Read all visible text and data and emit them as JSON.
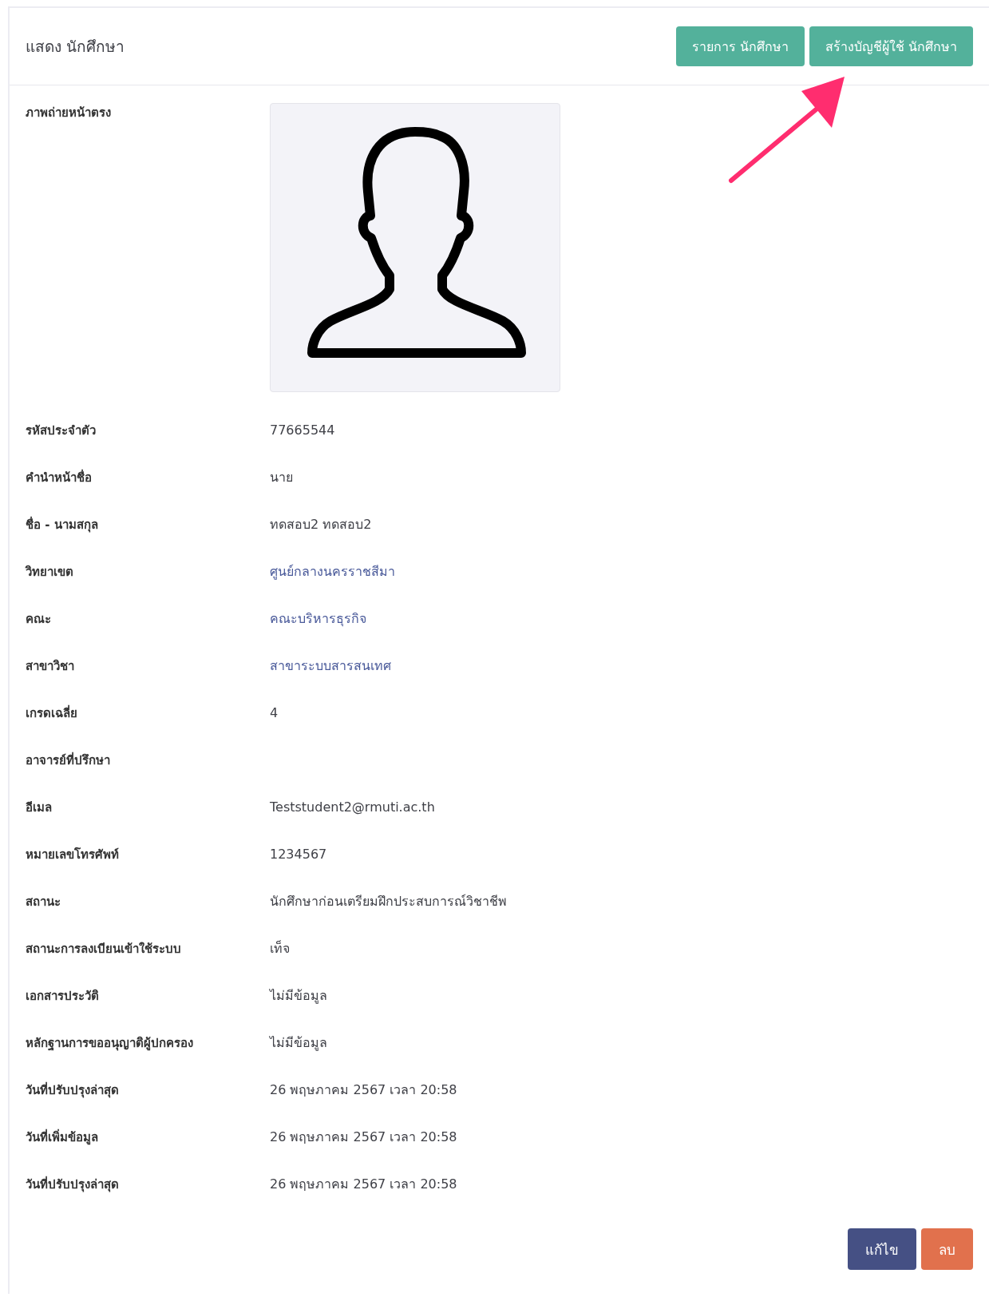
{
  "header": {
    "title": "แสดง นักศึกษา",
    "buttons": [
      {
        "label": "รายการ นักศึกษา"
      },
      {
        "label": "สร้างบัญชีผู้ใช้ นักศึกษา"
      }
    ]
  },
  "fields": [
    {
      "label": "ภาพถ่ายหน้าตรง",
      "kind": "photo"
    },
    {
      "label": "รหัสประจำตัว",
      "value": "77665544",
      "kind": "text"
    },
    {
      "label": "คำนำหน้าชื่อ",
      "value": "นาย",
      "kind": "text"
    },
    {
      "label": "ชื่อ - นามสกุล",
      "value": "ทดสอบ2 ทดสอบ2",
      "kind": "text"
    },
    {
      "label": "วิทยาเขต",
      "value": "ศูนย์กลางนครราชสีมา",
      "kind": "link"
    },
    {
      "label": "คณะ",
      "value": "คณะบริหารธุรกิจ",
      "kind": "link"
    },
    {
      "label": "สาขาวิชา",
      "value": "สาขาระบบสารสนเทศ",
      "kind": "link"
    },
    {
      "label": "เกรดเฉลี่ย",
      "value": "4",
      "kind": "text"
    },
    {
      "label": "อาจารย์ที่ปรึกษา",
      "kind": "text"
    },
    {
      "label": "อีเมล",
      "value": "Teststudent2@rmuti.ac.th",
      "kind": "text"
    },
    {
      "label": "หมายเลขโทรศัพท์",
      "value": "1234567",
      "kind": "text"
    },
    {
      "label": "สถานะ",
      "value": "นักศึกษาก่อนเตรียมฝึกประสบการณ์วิชาชีพ",
      "kind": "text"
    },
    {
      "label": "สถานะการลงเบียนเข้าใช้ระบบ",
      "value": "เท็จ",
      "kind": "text"
    },
    {
      "label": "เอกสารประวัติ",
      "value": "ไม่มีข้อมูล",
      "kind": "text"
    },
    {
      "label": "หลักฐานการขออนุญาติผู้ปกครอง",
      "value": "ไม่มีข้อมูล",
      "kind": "text"
    },
    {
      "label": "วันที่ปรับปรุงล่าสุด",
      "value": "26 พฤษภาคม 2567 เวลา 20:58",
      "kind": "text"
    },
    {
      "label": "วันที่เพิ่มข้อมูล",
      "value": "26 พฤษภาคม 2567 เวลา 20:58",
      "kind": "text"
    },
    {
      "label": "วันที่ปรับปรุงล่าสุด",
      "value": "26 พฤษภาคม 2567 เวลา 20:58",
      "kind": "text"
    }
  ],
  "actions": [
    {
      "label": "แก้ไข",
      "kind": "edit"
    },
    {
      "label": "ลบ",
      "kind": "delete"
    }
  ]
}
